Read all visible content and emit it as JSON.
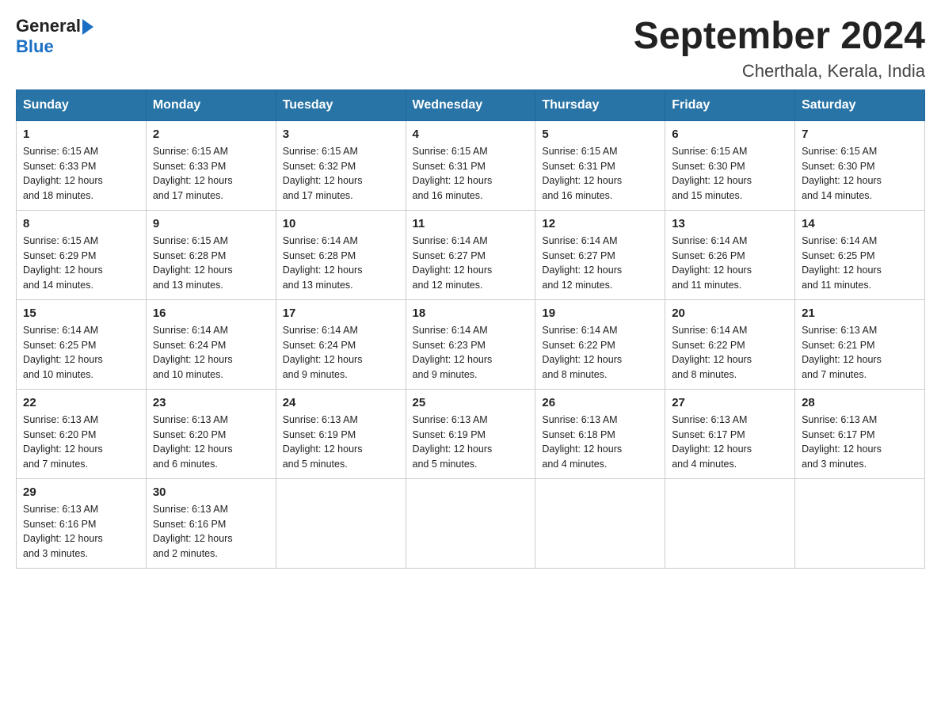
{
  "header": {
    "logo_general": "General",
    "logo_blue": "Blue",
    "title": "September 2024",
    "subtitle": "Cherthala, Kerala, India"
  },
  "weekdays": [
    "Sunday",
    "Monday",
    "Tuesday",
    "Wednesday",
    "Thursday",
    "Friday",
    "Saturday"
  ],
  "weeks": [
    [
      {
        "day": "1",
        "sunrise": "6:15 AM",
        "sunset": "6:33 PM",
        "daylight": "12 hours and 18 minutes."
      },
      {
        "day": "2",
        "sunrise": "6:15 AM",
        "sunset": "6:33 PM",
        "daylight": "12 hours and 17 minutes."
      },
      {
        "day": "3",
        "sunrise": "6:15 AM",
        "sunset": "6:32 PM",
        "daylight": "12 hours and 17 minutes."
      },
      {
        "day": "4",
        "sunrise": "6:15 AM",
        "sunset": "6:31 PM",
        "daylight": "12 hours and 16 minutes."
      },
      {
        "day": "5",
        "sunrise": "6:15 AM",
        "sunset": "6:31 PM",
        "daylight": "12 hours and 16 minutes."
      },
      {
        "day": "6",
        "sunrise": "6:15 AM",
        "sunset": "6:30 PM",
        "daylight": "12 hours and 15 minutes."
      },
      {
        "day": "7",
        "sunrise": "6:15 AM",
        "sunset": "6:30 PM",
        "daylight": "12 hours and 14 minutes."
      }
    ],
    [
      {
        "day": "8",
        "sunrise": "6:15 AM",
        "sunset": "6:29 PM",
        "daylight": "12 hours and 14 minutes."
      },
      {
        "day": "9",
        "sunrise": "6:15 AM",
        "sunset": "6:28 PM",
        "daylight": "12 hours and 13 minutes."
      },
      {
        "day": "10",
        "sunrise": "6:14 AM",
        "sunset": "6:28 PM",
        "daylight": "12 hours and 13 minutes."
      },
      {
        "day": "11",
        "sunrise": "6:14 AM",
        "sunset": "6:27 PM",
        "daylight": "12 hours and 12 minutes."
      },
      {
        "day": "12",
        "sunrise": "6:14 AM",
        "sunset": "6:27 PM",
        "daylight": "12 hours and 12 minutes."
      },
      {
        "day": "13",
        "sunrise": "6:14 AM",
        "sunset": "6:26 PM",
        "daylight": "12 hours and 11 minutes."
      },
      {
        "day": "14",
        "sunrise": "6:14 AM",
        "sunset": "6:25 PM",
        "daylight": "12 hours and 11 minutes."
      }
    ],
    [
      {
        "day": "15",
        "sunrise": "6:14 AM",
        "sunset": "6:25 PM",
        "daylight": "12 hours and 10 minutes."
      },
      {
        "day": "16",
        "sunrise": "6:14 AM",
        "sunset": "6:24 PM",
        "daylight": "12 hours and 10 minutes."
      },
      {
        "day": "17",
        "sunrise": "6:14 AM",
        "sunset": "6:24 PM",
        "daylight": "12 hours and 9 minutes."
      },
      {
        "day": "18",
        "sunrise": "6:14 AM",
        "sunset": "6:23 PM",
        "daylight": "12 hours and 9 minutes."
      },
      {
        "day": "19",
        "sunrise": "6:14 AM",
        "sunset": "6:22 PM",
        "daylight": "12 hours and 8 minutes."
      },
      {
        "day": "20",
        "sunrise": "6:14 AM",
        "sunset": "6:22 PM",
        "daylight": "12 hours and 8 minutes."
      },
      {
        "day": "21",
        "sunrise": "6:13 AM",
        "sunset": "6:21 PM",
        "daylight": "12 hours and 7 minutes."
      }
    ],
    [
      {
        "day": "22",
        "sunrise": "6:13 AM",
        "sunset": "6:20 PM",
        "daylight": "12 hours and 7 minutes."
      },
      {
        "day": "23",
        "sunrise": "6:13 AM",
        "sunset": "6:20 PM",
        "daylight": "12 hours and 6 minutes."
      },
      {
        "day": "24",
        "sunrise": "6:13 AM",
        "sunset": "6:19 PM",
        "daylight": "12 hours and 5 minutes."
      },
      {
        "day": "25",
        "sunrise": "6:13 AM",
        "sunset": "6:19 PM",
        "daylight": "12 hours and 5 minutes."
      },
      {
        "day": "26",
        "sunrise": "6:13 AM",
        "sunset": "6:18 PM",
        "daylight": "12 hours and 4 minutes."
      },
      {
        "day": "27",
        "sunrise": "6:13 AM",
        "sunset": "6:17 PM",
        "daylight": "12 hours and 4 minutes."
      },
      {
        "day": "28",
        "sunrise": "6:13 AM",
        "sunset": "6:17 PM",
        "daylight": "12 hours and 3 minutes."
      }
    ],
    [
      {
        "day": "29",
        "sunrise": "6:13 AM",
        "sunset": "6:16 PM",
        "daylight": "12 hours and 3 minutes."
      },
      {
        "day": "30",
        "sunrise": "6:13 AM",
        "sunset": "6:16 PM",
        "daylight": "12 hours and 2 minutes."
      },
      null,
      null,
      null,
      null,
      null
    ]
  ]
}
